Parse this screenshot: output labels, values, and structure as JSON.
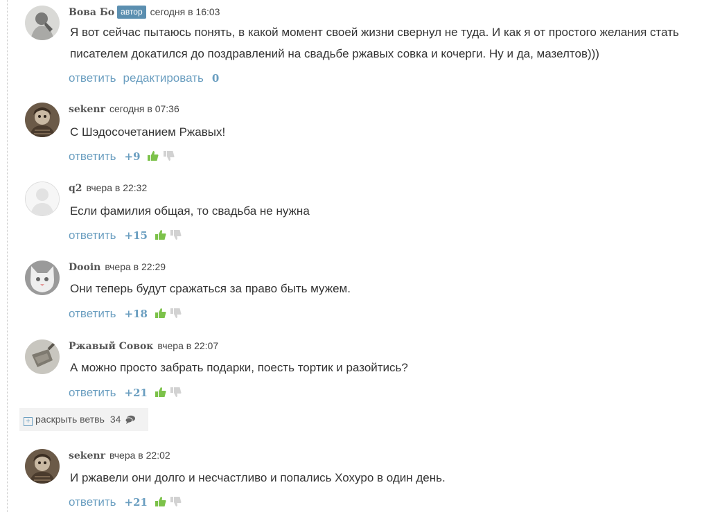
{
  "actions": {
    "reply": "ответить",
    "edit": "редактировать"
  },
  "comments": [
    {
      "nick": "Вова Бо",
      "badge": "автор",
      "time": "сегодня в 16:03",
      "text": "Я вот сейчас пытаюсь понять, в какой момент своей жизни свернул не туда. И как я от простого желания стать писателем докатился до поздравлений на свадьбе ржавых совка и кочерги. Ну и да, мазелтов)))",
      "rating": "0"
    },
    {
      "nick": "sekenr",
      "time": "сегодня в 07:36",
      "text": "С Шэдосочетанием Ржавых!",
      "rating": "+9"
    },
    {
      "nick": "q2",
      "time": "вчера в 22:32",
      "text": "Если фамилия общая, то свадьба не нужна",
      "rating": "+15"
    },
    {
      "nick": "Dooin",
      "time": "вчера в 22:29",
      "text": "Они теперь будут сражаться за право быть мужем.",
      "rating": "+18"
    },
    {
      "nick": "Ржавый Совок",
      "time": "вчера в 22:07",
      "text": "А можно просто забрать подарки, поесть тортик и разойтись?",
      "rating": "+21"
    },
    {
      "nick": "sekenr",
      "time": "вчера в 22:02",
      "text": "И ржавели они долго и несчастливо и попались Хохуро в один день.",
      "rating": "+21"
    }
  ],
  "expand": {
    "label": "раскрыть ветвь",
    "count": "34"
  },
  "colors": {
    "link": "#6a9ec0",
    "badge": "#5b8fb0",
    "like": "#7cc24a",
    "dislike": "#d2d2d2"
  }
}
